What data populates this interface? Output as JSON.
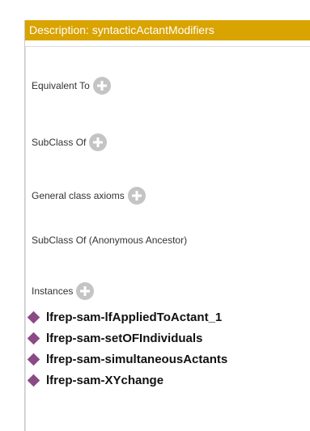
{
  "title": "Description: syntacticActantModifiers",
  "sections": [
    {
      "label": "Equivalent To",
      "has_add": true
    },
    {
      "label": "SubClass Of",
      "has_add": true
    },
    {
      "label": "General class axioms",
      "has_add": true
    },
    {
      "label": "SubClass Of (Anonymous Ancestor)",
      "has_add": false
    },
    {
      "label": "Instances",
      "has_add": true
    }
  ],
  "instances": [
    "lfrep-sam-lfAppliedToActant_1",
    "lfrep-sam-setOFIndividuals",
    "lfrep-sam-simultaneousActants",
    "lfrep-sam-XYchange"
  ],
  "colors": {
    "titlebar": "#d9a300",
    "instance_icon": "#8b4a86",
    "add_button": "#c4c4c4"
  }
}
